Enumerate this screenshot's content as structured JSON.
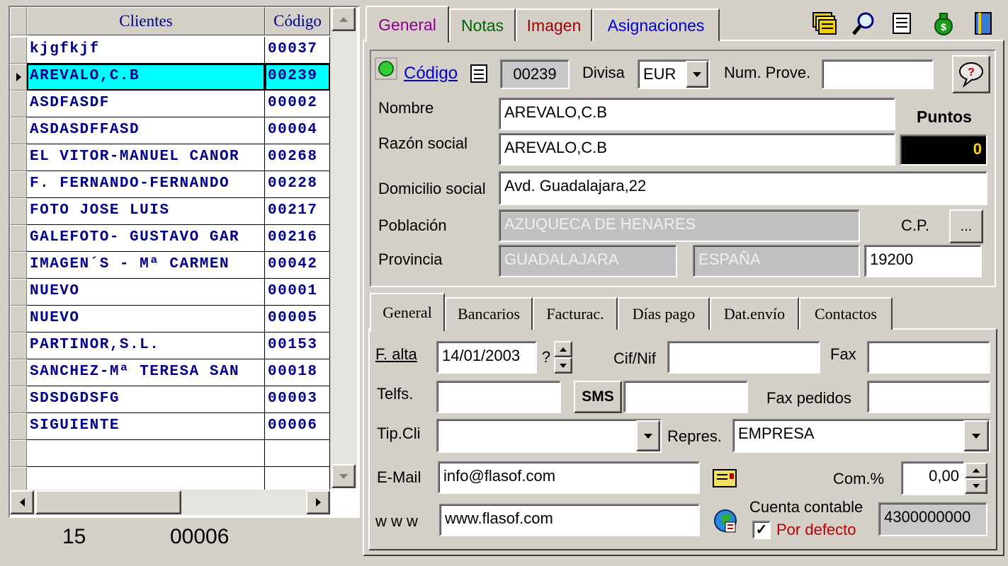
{
  "grid": {
    "col_clientes": "Clientes",
    "col_codigo": "Código",
    "rows": [
      {
        "name": "kjgfkjf",
        "code": "00037"
      },
      {
        "name": "AREVALO,C.B",
        "code": "00239"
      },
      {
        "name": "ASDFASDF",
        "code": "00002"
      },
      {
        "name": "ASDASDFFASD",
        "code": "00004"
      },
      {
        "name": "EL VITOR-MANUEL CANOR",
        "code": "00268"
      },
      {
        "name": "F. FERNANDO-FERNANDO",
        "code": "00228"
      },
      {
        "name": "FOTO JOSE LUIS",
        "code": "00217"
      },
      {
        "name": "GALEFOTO- GUSTAVO GAR",
        "code": "00216"
      },
      {
        "name": "IMAGEN´S - Mª CARMEN",
        "code": "00042"
      },
      {
        "name": "NUEVO",
        "code": "00001"
      },
      {
        "name": "NUEVO",
        "code": "00005"
      },
      {
        "name": "PARTINOR,S.L.",
        "code": "00153"
      },
      {
        "name": "SANCHEZ-Mª TERESA SAN",
        "code": "00018"
      },
      {
        "name": "SDSDGDSFG",
        "code": "00003"
      },
      {
        "name": "SIGUIENTE",
        "code": "00006"
      }
    ],
    "selected_index": 1,
    "footer_count": "15",
    "footer_code": "00006"
  },
  "top_tabs": {
    "general": "General",
    "notas": "Notas",
    "imagen": "Imagen",
    "asignaciones": "Asignaciones"
  },
  "header": {
    "codigo_label": "Código",
    "codigo_value": "00239",
    "divisa_label": "Divisa",
    "divisa_value": "EUR",
    "num_prove_label": "Num. Prove.",
    "num_prove_value": "",
    "nombre_label": "Nombre",
    "nombre_value": "AREVALO,C.B",
    "razon_label": "Razón social",
    "razon_value": "AREVALO,C.B",
    "puntos_label": "Puntos",
    "puntos_value": "0",
    "domicilio_label": "Domicilio social",
    "domicilio_value": "Avd. Guadalajara,22",
    "poblacion_label": "Población",
    "poblacion_value": "AZUQUECA DE HENARES",
    "cp_label": "C.P.",
    "cp_button": "...",
    "provincia_label": "Provincia",
    "provincia_value": "GUADALAJARA",
    "pais_value": "ESPAÑA",
    "cp_value": "19200"
  },
  "sub_tabs": {
    "general": "General",
    "bancarios": "Bancarios",
    "facturac": "Facturac.",
    "dias_pago": "Días pago",
    "dat_envio": "Dat.envío",
    "contactos": "Contactos"
  },
  "detail": {
    "f_alta_label": "F. alta",
    "f_alta_value": "14/01/2003",
    "f_alta_q": "?",
    "cif_label": "Cif/Nif",
    "cif_value": "",
    "fax_label": "Fax",
    "fax_value": "",
    "telfs_label": "Telfs.",
    "telfs_value": "",
    "sms_label": "SMS",
    "sms_value": "",
    "fax_pedidos_label": "Fax pedidos",
    "fax_pedidos_value": "",
    "tipcli_label": "Tip.Cli",
    "tipcli_value": "",
    "repres_label": "Repres.",
    "repres_value": "EMPRESA",
    "email_label": "E-Mail",
    "email_value": "info@flasof.com",
    "com_label": "Com.%",
    "com_value": "0,00",
    "www_label": "w w w",
    "www_value": "www.flasof.com",
    "cuenta_label": "Cuenta contable",
    "por_defecto_label": "Por defecto",
    "cuenta_value": "4300000000"
  },
  "colors": {
    "selected_row": "#00ffff",
    "grid_text": "#00008b",
    "tab_general": "#8b008b",
    "tab_notas": "#006400",
    "tab_imagen": "#a00000",
    "tab_asignaciones": "#0000cd",
    "link": "#0000cd",
    "por_defecto": "#c00000"
  }
}
